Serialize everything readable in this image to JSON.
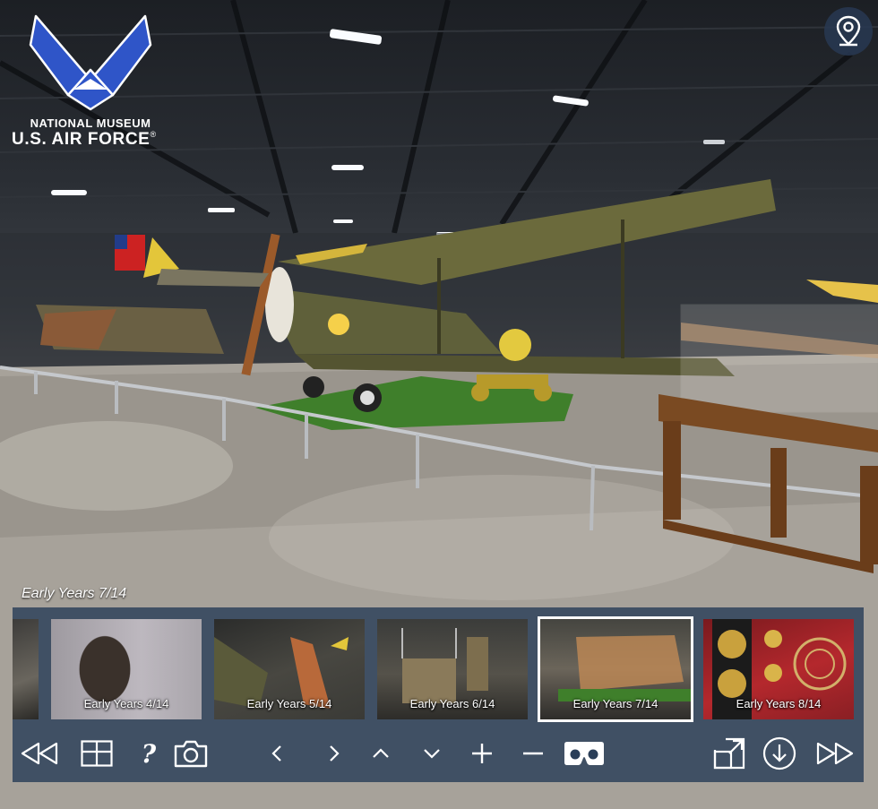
{
  "brand": {
    "line1": "NATIONAL MUSEUM",
    "line2": "U.S. AIR FORCE",
    "registered": "®"
  },
  "current_scene": {
    "caption": "Early Years 7/14"
  },
  "thumbnails": [
    {
      "label": "",
      "partial": true
    },
    {
      "label": "Early Years 4/14"
    },
    {
      "label": "Early Years 5/14"
    },
    {
      "label": "Early Years 6/14"
    },
    {
      "label": "Early Years 7/14",
      "active": true
    },
    {
      "label": "Early Years 8/14"
    }
  ],
  "controls": {
    "icons": [
      "rewind-icon",
      "grid-icon",
      "help-icon",
      "camera-icon",
      "chevron-left-icon",
      "chevron-right-icon",
      "chevron-up-icon",
      "chevron-down-icon",
      "plus-icon",
      "minus-icon",
      "vr-headset-icon",
      "fullscreen-icon",
      "download-icon",
      "fast-forward-icon"
    ],
    "help_label": "?"
  },
  "colors": {
    "bar_background": "#2a3e58",
    "accent_wing_blue": "#2f55c8",
    "active_border": "#ffffff"
  }
}
